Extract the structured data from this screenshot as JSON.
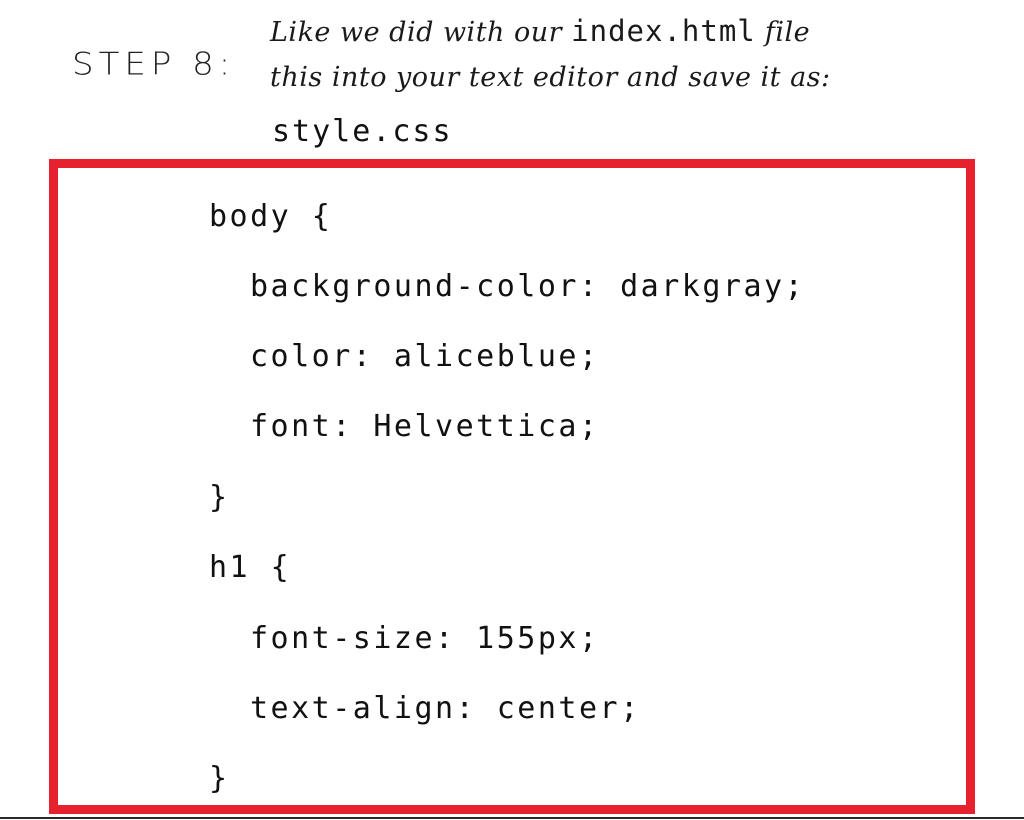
{
  "step": {
    "label": "STEP 8:"
  },
  "instruction": {
    "line1_prefix": "Like we did with our ",
    "line1_code": "index.html",
    "line1_suffix": " file",
    "line2": "this into your text editor and save it as:",
    "filename": "style.css"
  },
  "code": {
    "lines": [
      "body {",
      "background-color: darkgray;",
      "color: aliceblue;",
      "font: Helvettica;",
      "}",
      "h1 {",
      "font-size: 155px;",
      "text-align: center;",
      "}"
    ]
  },
  "colors": {
    "frame": "#e8212f",
    "text": "#111111",
    "background": "#ffffff"
  }
}
